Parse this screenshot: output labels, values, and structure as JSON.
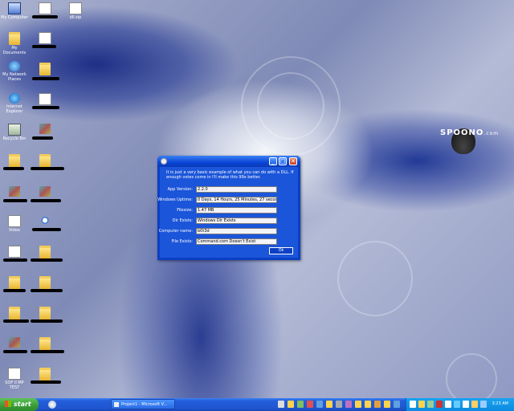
{
  "desktop": {
    "icons": [
      {
        "label": "My Computer",
        "icon": "computer-icon"
      },
      {
        "label": "My Documents",
        "icon": "documents-folder-icon"
      },
      {
        "label": "My Network Places",
        "icon": "network-icon"
      },
      {
        "label": "Internet Explorer",
        "icon": "ie-icon"
      },
      {
        "label": "Recycle Bin",
        "icon": "recycle-bin-icon"
      },
      {
        "label": "Video",
        "icon": "video-icon"
      },
      {
        "label": "SOF II MP TEST",
        "icon": "game-icon"
      },
      {
        "label": "dll.zip",
        "icon": "zip-icon"
      }
    ],
    "logo_text": "SPOONO",
    "logo_suffix": ".com"
  },
  "window": {
    "message": "It is just a very basic example of what you can do with a DLL.  If enough votes come in I'll make this 99x better.",
    "fields": [
      {
        "label": "App Version:",
        "value": "2.2.0"
      },
      {
        "label": "Windows Uptime:",
        "value": "0 Days, 14 Hours, 25 Minutes, 27 seconds"
      },
      {
        "label": "Filesize:",
        "value": "1.47 MB"
      },
      {
        "label": "Dir Exists:",
        "value": "Windows Dir Exists"
      },
      {
        "label": "Computer name:",
        "value": "b0t3d"
      },
      {
        "label": "File Exists:",
        "value": "Command.com Doesn't Exist"
      }
    ],
    "ok_label": "Ok",
    "minimize_glyph": "_",
    "maximize_glyph": "□",
    "close_glyph": "✕"
  },
  "taskbar": {
    "start_label": "start",
    "task_label": "Project1 - Microsoft V...",
    "clock": "3:23 AM"
  }
}
